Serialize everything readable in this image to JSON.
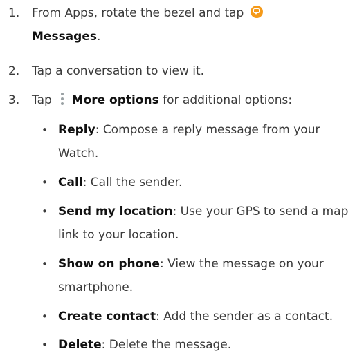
{
  "steps": [
    {
      "number": "1.",
      "line1_text": "From Apps, rotate the bezel and tap",
      "icon": "messages-icon",
      "line2_bold": "Messages",
      "line2_suffix": "."
    },
    {
      "number": "2.",
      "text": "Tap a conversation to view it."
    },
    {
      "number": "3.",
      "prefix": "Tap",
      "icon": "more-options-icon",
      "bold": "More options",
      "suffix": " for additional options:"
    }
  ],
  "options": [
    {
      "bullet": "•",
      "label": "Reply",
      "sep": ":",
      "lines": [
        " Compose a reply message from your",
        "Watch."
      ]
    },
    {
      "bullet": "•",
      "label": "Call",
      "sep": ":",
      "lines": [
        " Call the sender."
      ]
    },
    {
      "bullet": "•",
      "label": "Send my location",
      "sep": ":",
      "lines": [
        " Use your GPS to send a map",
        "link to your location."
      ]
    },
    {
      "bullet": "•",
      "label": "Show on phone",
      "sep": ":",
      "lines": [
        " View the message on your",
        "smartphone."
      ]
    },
    {
      "bullet": "•",
      "label": "Create contact",
      "sep": ":",
      "lines": [
        " Add the sender as a contact."
      ]
    },
    {
      "bullet": "•",
      "label": "Delete",
      "sep": ":",
      "lines": [
        " Delete the message."
      ]
    }
  ],
  "colors": {
    "text": "#3a3a3a",
    "bold": "#111111",
    "messages_icon": "#f59a19",
    "more_icon": "#9aa1a4"
  }
}
